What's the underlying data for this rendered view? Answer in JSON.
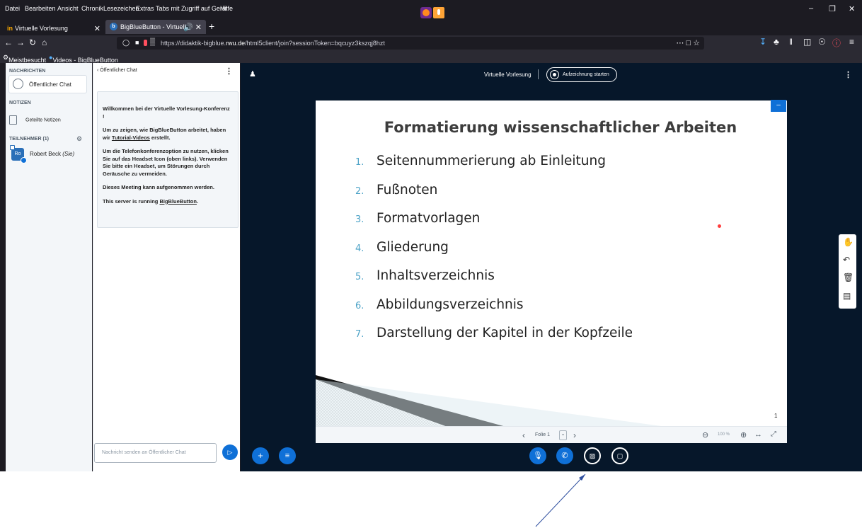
{
  "menubar": {
    "items": [
      "Datei",
      "Bearbeiten",
      "Ansicht",
      "Chronik",
      "Lesezeichen",
      "Extras",
      "Tabs mit Zugriff auf Gerät",
      "Hilfe"
    ]
  },
  "tabs": [
    {
      "label": "Virtuelle Vorlesung",
      "logo": "in"
    },
    {
      "label": "BigBlueButton - Virtuelle Vo",
      "active": true
    }
  ],
  "urlbar": {
    "prefix": "https://didaktik-bigblue.",
    "domain": "rwu.de",
    "path": "/html5client/join?sessionToken=bqcuyz3kszqj8hzt"
  },
  "bookmarks": [
    "Meistbesucht",
    "Videos - BigBlueButton"
  ],
  "sidebar": {
    "messages_title": "NACHRICHTEN",
    "public_chat": "Öffentlicher Chat",
    "notes_title": "NOTIZEN",
    "shared_notes": "Geteilte Notizen",
    "participants_title": "TEILNEHMER (1)",
    "user_initials": "Ro",
    "user_name": "Robert Beck",
    "user_you": "(Sie)"
  },
  "chat": {
    "back_label": "Öffentlicher Chat",
    "welcome_1a": "Willkommen bei der ",
    "welcome_1b": "Virtuelle Vorlesung",
    "welcome_1c": "-Konferenz !",
    "welcome_2a": "Um zu zeigen, wie BigBlueButton arbeitet, haben wir ",
    "welcome_2link": "Tutorial-Videos",
    "welcome_2b": " erstellt.",
    "welcome_3a": "Um die Telefonkonferenzoption zu nutzen, klicken Sie auf das Headset Icon (oben links). ",
    "welcome_3b": "Verwenden Sie bitte ein Headset, um Störungen durch Geräusche zu vermeiden.",
    "welcome_4": "Dieses Meeting kann aufgenommen werden.",
    "welcome_5a": "This server is running ",
    "welcome_5link": "BigBlueButton",
    "welcome_5b": ".",
    "input_placeholder": "Nachricht senden an Öffentlicher Chat"
  },
  "stage": {
    "meeting_title": "Virtuelle Vorlesung",
    "record_label": "Aufzeichnung starten"
  },
  "slide": {
    "title": "Formatierung wissenschaftlicher Arbeiten",
    "items": [
      {
        "n": "1.",
        "t": "Seitennummerierung ab Einleitung"
      },
      {
        "n": "2.",
        "t": "Fußnoten"
      },
      {
        "n": "3.",
        "t": "Formatvorlagen"
      },
      {
        "n": "4.",
        "t": "Gliederung"
      },
      {
        "n": "5.",
        "t": "Inhaltsverzeichnis"
      },
      {
        "n": "6.",
        "t": "Abbildungsverzeichnis"
      },
      {
        "n": "7.",
        "t": "Darstellung der Kapitel in der Kopfzeile"
      }
    ],
    "page_number": "1",
    "folie_label": "Folie 1",
    "zoom": "100 %"
  },
  "colors": {
    "accent": "#0f70d7",
    "stage_bg": "#06172a",
    "browser_bg": "#1c1b22",
    "item_number": "#4da3c7",
    "arrow": "#2f4f9f"
  }
}
